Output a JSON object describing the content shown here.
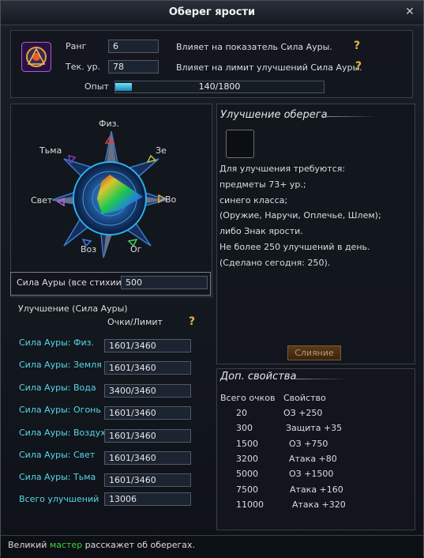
{
  "window": {
    "title": "Оберег ярости",
    "close": "✕"
  },
  "top": {
    "rank_label": "Ранг",
    "rank_value": "6",
    "rank_desc": "Влияет на показатель Сила Ауры.",
    "level_label": "Тек. ур.",
    "level_value": "78",
    "level_desc": "Влияет на лимит улучшений Сила Ауры.",
    "exp_label": "Опыт",
    "exp_text": "140/1800",
    "exp_progress": 0.078
  },
  "compass": {
    "labels": [
      "Физ.",
      "Зе",
      "Во",
      "Ог",
      "Воз",
      "Свет",
      "Тьма"
    ]
  },
  "aura_all": {
    "label": "Сила Ауры (все стихии)",
    "value": "500"
  },
  "upgrade_section": {
    "title": "Улучшение (Сила Ауры)",
    "points_header": "Очки/Лимит"
  },
  "stats": [
    {
      "label": "Сила Ауры: Физ.",
      "value": "1601/3460"
    },
    {
      "label": "Сила Ауры: Земля",
      "value": "1601/3460"
    },
    {
      "label": "Сила Ауры: Вода",
      "value": "3400/3460"
    },
    {
      "label": "Сила Ауры: Огонь",
      "value": "1601/3460"
    },
    {
      "label": "Сила Ауры: Воздух",
      "value": "1601/3460"
    },
    {
      "label": "Сила Ауры: Свет",
      "value": "1601/3460"
    },
    {
      "label": "Сила Ауры: Тьма",
      "value": "1601/3460"
    }
  ],
  "total": {
    "label": "Всего улучшений",
    "value": "13006"
  },
  "improve": {
    "header": "Улучшение оберега",
    "lines": [
      "Для улучшения требуются:",
      "предметы 73+ ур.;",
      "синего класса;",
      "(Оружие, Наручи, Оплечье, Шлем);",
      "либо Знак ярости.",
      "Не более 250 улучшений в день.",
      "(Сделано сегодня: 250)."
    ],
    "merge_button": "Слияние"
  },
  "extra": {
    "header": "Доп. свойства",
    "col1": "Всего очков",
    "col2": "Свойство",
    "rows": [
      {
        "points": "20",
        "prop": "ОЗ +250"
      },
      {
        "points": "300",
        "prop": "Защита +35"
      },
      {
        "points": "1500",
        "prop": "ОЗ +750"
      },
      {
        "points": "3200",
        "prop": "Атака +80"
      },
      {
        "points": "5000",
        "prop": "ОЗ +1500"
      },
      {
        "points": "7500",
        "prop": "Атака +160"
      },
      {
        "points": "11000",
        "prop": "Атака +320"
      }
    ]
  },
  "status": {
    "before": "Великий ",
    "highlight": "мастер",
    "after": " расскажет об оберегах."
  }
}
